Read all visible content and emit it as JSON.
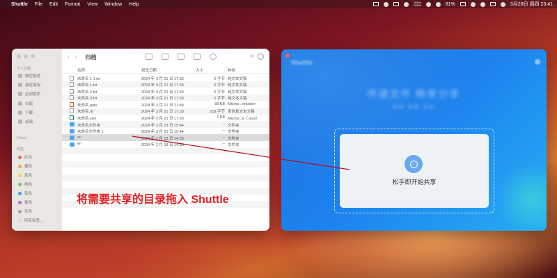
{
  "menubar": {
    "app": "Shuttle",
    "menus": [
      "File",
      "Edit",
      "Format",
      "View",
      "Window",
      "Help"
    ],
    "network_up": "0KB/s",
    "network_down": "0KB/s",
    "battery": "81%",
    "datetime": "3月28日 周四 23:41"
  },
  "finder": {
    "title": "归档",
    "sidebar": {
      "favorites_header": "个人收藏",
      "favorites": [
        "隔空投送",
        "最近使用",
        "应用程序",
        "文稿",
        "下载",
        "桌面"
      ],
      "icloud_header": "iCloud",
      "tags_header": "标签",
      "tags": [
        {
          "label": "红色",
          "color": "#f25b57"
        },
        {
          "label": "橙色",
          "color": "#f5a547"
        },
        {
          "label": "黄色",
          "color": "#f5d547"
        },
        {
          "label": "绿色",
          "color": "#5fcf5b"
        },
        {
          "label": "蓝色",
          "color": "#4a9af0"
        },
        {
          "label": "紫色",
          "color": "#b46be0"
        },
        {
          "label": "灰色",
          "color": "#a0a0a0"
        },
        {
          "label": "所有标签…",
          "color": "#d9d9d9"
        }
      ]
    },
    "columns": {
      "name": "名称",
      "date": "修改日期",
      "size": "大小",
      "kind": "种类"
    },
    "files": [
      {
        "name": "未命名 1 1.txt",
        "date": "2024 年 3 月 21 日 17:33",
        "size": "0 字节",
        "kind": "纯文本文稿",
        "icon": "txt-file-icon",
        "folder": false
      },
      {
        "name": "未命名 1.txt",
        "date": "2024 年 3 月 21 日 17:33",
        "size": "0 字节",
        "kind": "纯文本文稿",
        "icon": "txt-file-icon",
        "folder": false
      },
      {
        "name": "未命名 2.txt",
        "date": "2024 年 3 月 21 日 17:33",
        "size": "0 字节",
        "kind": "纯文本文稿",
        "icon": "txt-file-icon",
        "folder": false
      },
      {
        "name": "未命名 3.txt",
        "date": "2024 年 3 月 21 日 17:33",
        "size": "0 字节",
        "kind": "纯文本文稿",
        "icon": "txt-file-icon",
        "folder": false
      },
      {
        "name": "未命名.pptx",
        "date": "2024 年 3 月 22 日 21:48",
        "size": "38 KB",
        "kind": "Micros...entation",
        "icon": "pptx-file-icon",
        "folder": false
      },
      {
        "name": "未命名.rtf",
        "date": "2024 年 3 月 21 日 17:33",
        "size": "219 字节",
        "kind": "多信息文本文稿",
        "icon": "rtf-file-icon",
        "folder": false
      },
      {
        "name": "未命名.xlsx",
        "date": "2024 年 3 月 21 日 17:33",
        "size": "7 KB",
        "kind": "Micros...k（.xlsx）",
        "icon": "xlsx-file-icon",
        "folder": false
      },
      {
        "name": "未命名文件夹",
        "date": "2024 年 3 月 23 日 15:44",
        "size": "--",
        "kind": "文件夹",
        "icon": "folder-icon",
        "folder": true
      },
      {
        "name": "未命名文件夹 1",
        "date": "2024 年 3 月 23 日 15:44",
        "size": "--",
        "kind": "文件夹",
        "icon": "folder-icon",
        "folder": true
      },
      {
        "name": "cn",
        "date": "2024 年 2 月 18 日 14:33",
        "size": "--",
        "kind": "文件夹",
        "icon": "folder-icon",
        "folder": true,
        "selected": true
      },
      {
        "name": "en",
        "date": "2024 年 2 月 18 日 14:33",
        "size": "--",
        "kind": "文件夹",
        "icon": "folder-icon",
        "folder": true
      }
    ]
  },
  "instruction": "将需要共享的目录拖入 Shuttle",
  "shuttle": {
    "logo": "Shuttle",
    "slogan": "传递文件 畅享分享",
    "sub": "简单 快速 高效",
    "drop_label": "松手即开始共享",
    "accent": "#1d83ef"
  }
}
